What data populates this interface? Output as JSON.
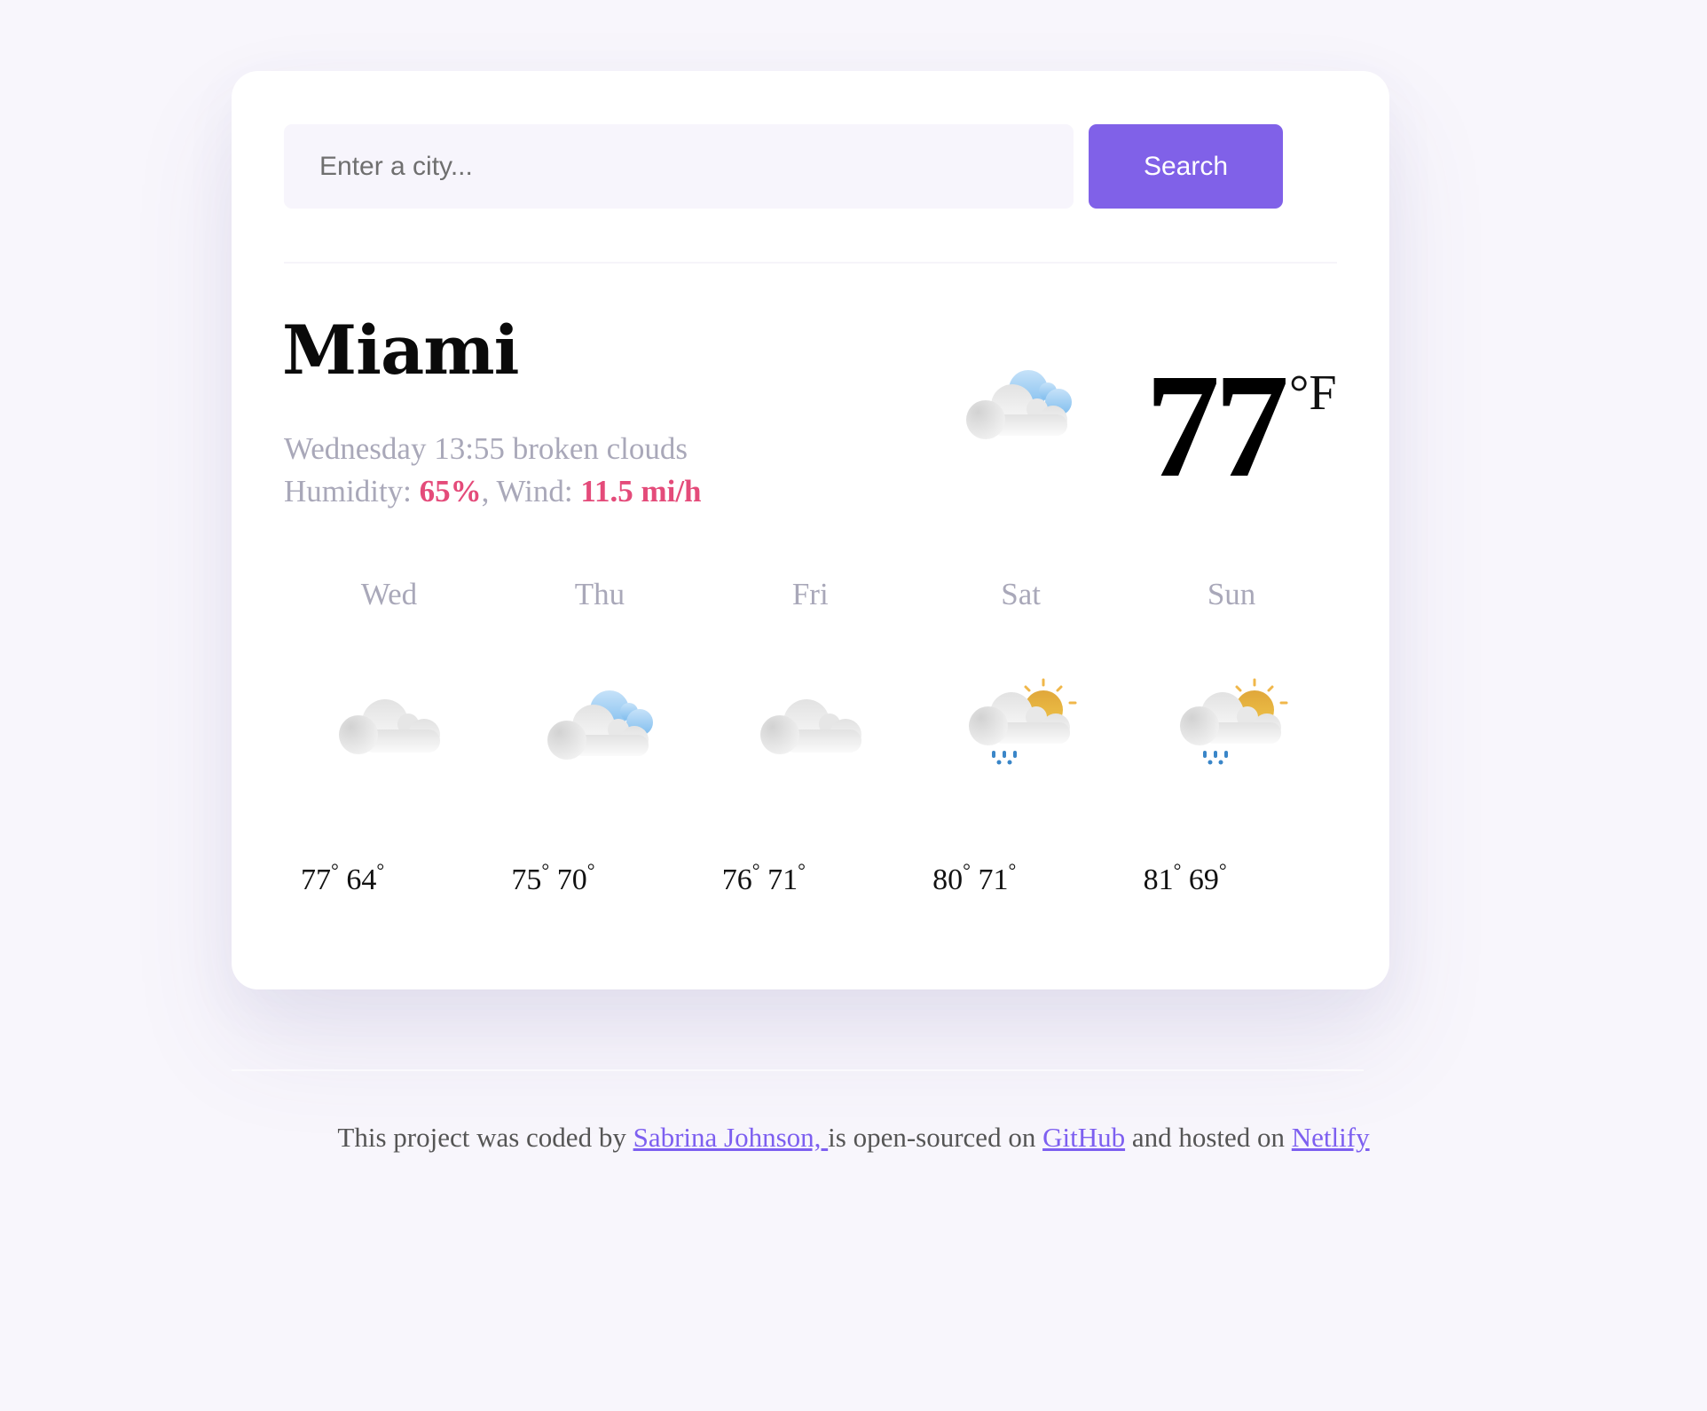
{
  "search": {
    "placeholder": "Enter a city...",
    "value": "",
    "button_label": "Search"
  },
  "current": {
    "city": "Miami",
    "day_time": "Wednesday 13:55",
    "description": "broken clouds",
    "humidity_label": "Humidity:",
    "humidity_value": "65%",
    "wind_label": "Wind:",
    "wind_value": "11.5 mi/h",
    "icon": "broken-clouds-icon",
    "temperature": "77",
    "unit": "°F"
  },
  "forecast": [
    {
      "day": "Wed",
      "icon": "clouds-icon",
      "max": "77",
      "min": "64"
    },
    {
      "day": "Thu",
      "icon": "broken-clouds-icon",
      "max": "75",
      "min": "70"
    },
    {
      "day": "Fri",
      "icon": "clouds-icon",
      "max": "76",
      "min": "71"
    },
    {
      "day": "Sat",
      "icon": "sun-cloud-rain-icon",
      "max": "80",
      "min": "71"
    },
    {
      "day": "Sun",
      "icon": "sun-cloud-rain-icon",
      "max": "81",
      "min": "69"
    }
  ],
  "degree_symbol": "°",
  "footer": {
    "text_1": "This project was coded by ",
    "author_link": "Sabrina Johnson, ",
    "text_2": "is open-sourced on ",
    "github_link": "GitHub",
    "text_3": " and hosted on ",
    "netlify_link": "Netlify"
  },
  "colors": {
    "accent": "#8061e8",
    "highlight": "#e44b7a",
    "link": "#7d5ff0",
    "background": "#f8f6fc"
  }
}
